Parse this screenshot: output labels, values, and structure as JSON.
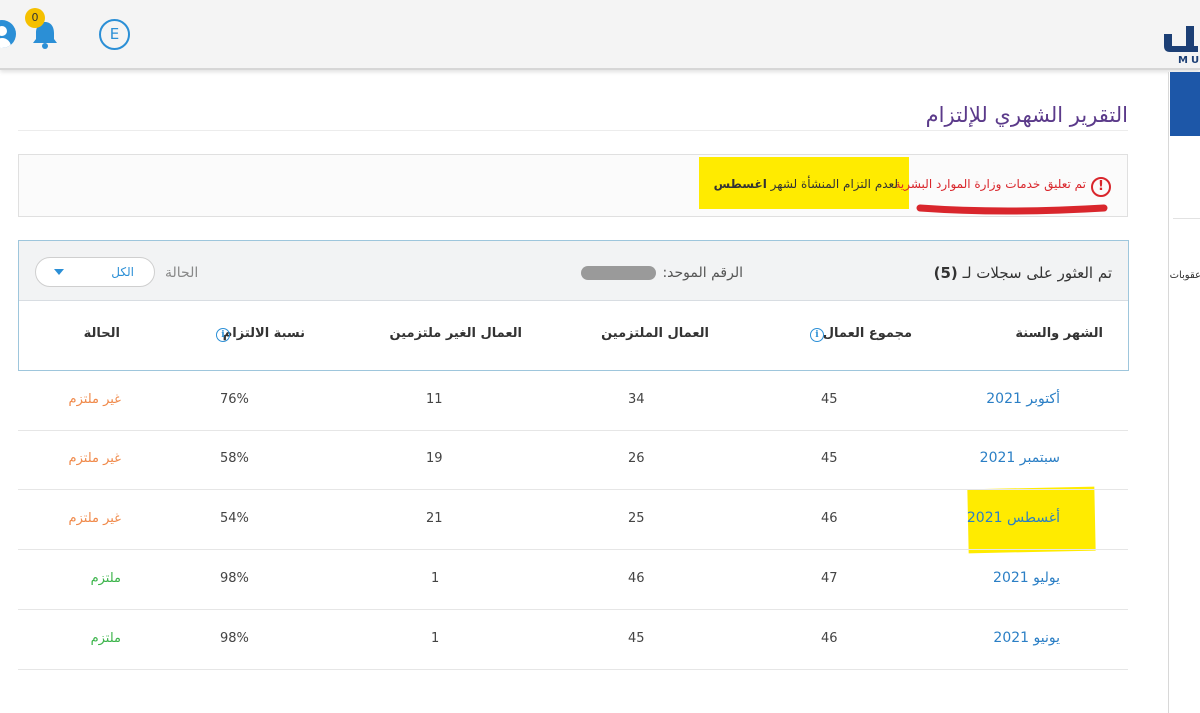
{
  "topbar": {
    "notifications_count": "0",
    "user_initial": "E",
    "logo_text": "MU"
  },
  "side_panel": {
    "label": "عقوبات"
  },
  "page": {
    "title": "التقرير الشهري للإلتزام"
  },
  "alert": {
    "red_text": "تم تعليق خدمات وزارة الموارد البشرية",
    "black_text": "لعدم التزام المنشأة لشهر",
    "black_bold": "اغسطس"
  },
  "table": {
    "records_label": "تم العثور على سجلات لـ",
    "records_count": "(5)",
    "unified_label": "الرقم الموحد:",
    "status_filter_label": "الحالة",
    "status_filter_value": "الكل",
    "columns": {
      "month_year": "الشهر والسنة",
      "total_workers": "مجموع العمال",
      "committed": "العمال الملتزمين",
      "not_committed": "العمال الغير ملتزمين",
      "ratio": "نسبة الالتزام",
      "status": "الحالة"
    },
    "rows": [
      {
        "month": "أكتوبر 2021",
        "total": "45",
        "committed": "34",
        "not_committed": "11",
        "ratio": "76%",
        "status": "غير ملتزم"
      },
      {
        "month": "سبتمبر 2021",
        "total": "45",
        "committed": "26",
        "not_committed": "19",
        "ratio": "58%",
        "status": "غير ملتزم"
      },
      {
        "month": "أغسطس 2021",
        "total": "46",
        "committed": "25",
        "not_committed": "21",
        "ratio": "54%",
        "status": "غير ملتزم"
      },
      {
        "month": "يوليو 2021",
        "total": "47",
        "committed": "46",
        "not_committed": "1",
        "ratio": "98%",
        "status": "ملتزم"
      },
      {
        "month": "يونيو 2021",
        "total": "46",
        "committed": "45",
        "not_committed": "1",
        "ratio": "98%",
        "status": "ملتزم"
      }
    ]
  },
  "colors": {
    "accent": "#2b8fd6",
    "title": "#5b3a8a",
    "alert_red": "#d9262c",
    "highlight": "#ffeb00",
    "status_not_committed": "#f08a4b",
    "status_committed": "#3cb44b",
    "sidebar_active": "#1d57a8"
  },
  "icons": {
    "user": "user-icon",
    "bell": "bell-icon",
    "alert": "exclamation-circle-icon",
    "info": "info-icon",
    "dropdown": "chevron-down-icon"
  }
}
